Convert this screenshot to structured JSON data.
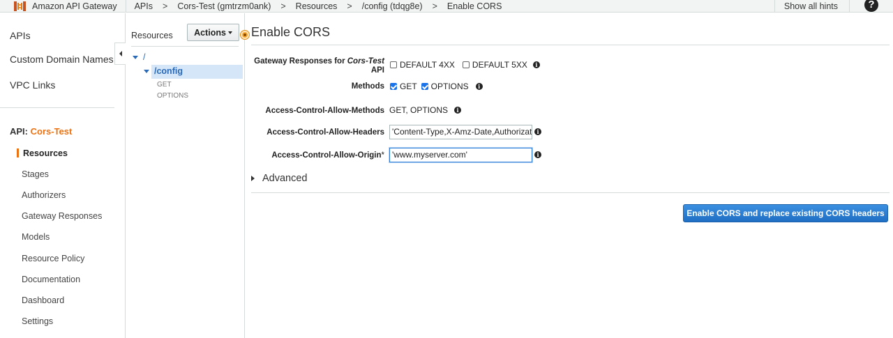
{
  "topbar": {
    "app_name": "Amazon API Gateway",
    "breadcrumbs": [
      {
        "label": "APIs"
      },
      {
        "label": "Cors-Test (gmtrzm0ank)"
      },
      {
        "label": "Resources"
      },
      {
        "label": "/config (tdqg8e)"
      },
      {
        "label": "Enable CORS"
      }
    ],
    "separator": ">",
    "show_hints": "Show all hints",
    "help_glyph": "?"
  },
  "leftnav": {
    "top_items": [
      {
        "label": "APIs"
      },
      {
        "label": "Custom Domain Names"
      },
      {
        "label": "VPC Links"
      }
    ],
    "api_prefix": "API:",
    "api_name": "Cors-Test",
    "sub_items": [
      {
        "label": "Resources",
        "active": true
      },
      {
        "label": "Stages"
      },
      {
        "label": "Authorizers"
      },
      {
        "label": "Gateway Responses"
      },
      {
        "label": "Models"
      },
      {
        "label": "Resource Policy"
      },
      {
        "label": "Documentation"
      },
      {
        "label": "Dashboard"
      },
      {
        "label": "Settings"
      }
    ]
  },
  "resources": {
    "title": "Resources",
    "actions_label": "Actions",
    "tree": {
      "root": "/",
      "child": "/config",
      "methods": [
        "GET",
        "OPTIONS"
      ]
    }
  },
  "main": {
    "title": "Enable CORS",
    "gateway_responses": {
      "label_prefix": "Gateway Responses for ",
      "label_italic": "Cors-Test",
      "label_suffix": " API",
      "options": [
        {
          "label": "DEFAULT 4XX",
          "checked": false
        },
        {
          "label": "DEFAULT 5XX",
          "checked": false
        }
      ]
    },
    "methods": {
      "label": "Methods",
      "options": [
        {
          "label": "GET",
          "checked": true
        },
        {
          "label": "OPTIONS",
          "checked": true
        }
      ]
    },
    "allow_methods": {
      "label": "Access-Control-Allow-Methods",
      "value": "GET, OPTIONS"
    },
    "allow_headers": {
      "label": "Access-Control-Allow-Headers",
      "value": "'Content-Type,X-Amz-Date,Authorizatio"
    },
    "allow_origin": {
      "label": "Access-Control-Allow-Origin",
      "required_mark": "*",
      "value": "'www.myserver.com'"
    },
    "advanced_label": "Advanced",
    "submit_label": "Enable CORS and replace existing CORS headers",
    "info_glyph": "i"
  },
  "colors": {
    "accent_orange": "#ec7211",
    "link_blue": "#2a6ab8",
    "primary_button": "#1f6fc4"
  },
  "icons": {
    "brand": "api-gateway-logo-icon",
    "help": "help-icon",
    "info": "info-icon",
    "collapse": "chevron-left-icon",
    "tree_expand": "caret-down-icon",
    "advanced_expand": "caret-right-icon"
  }
}
